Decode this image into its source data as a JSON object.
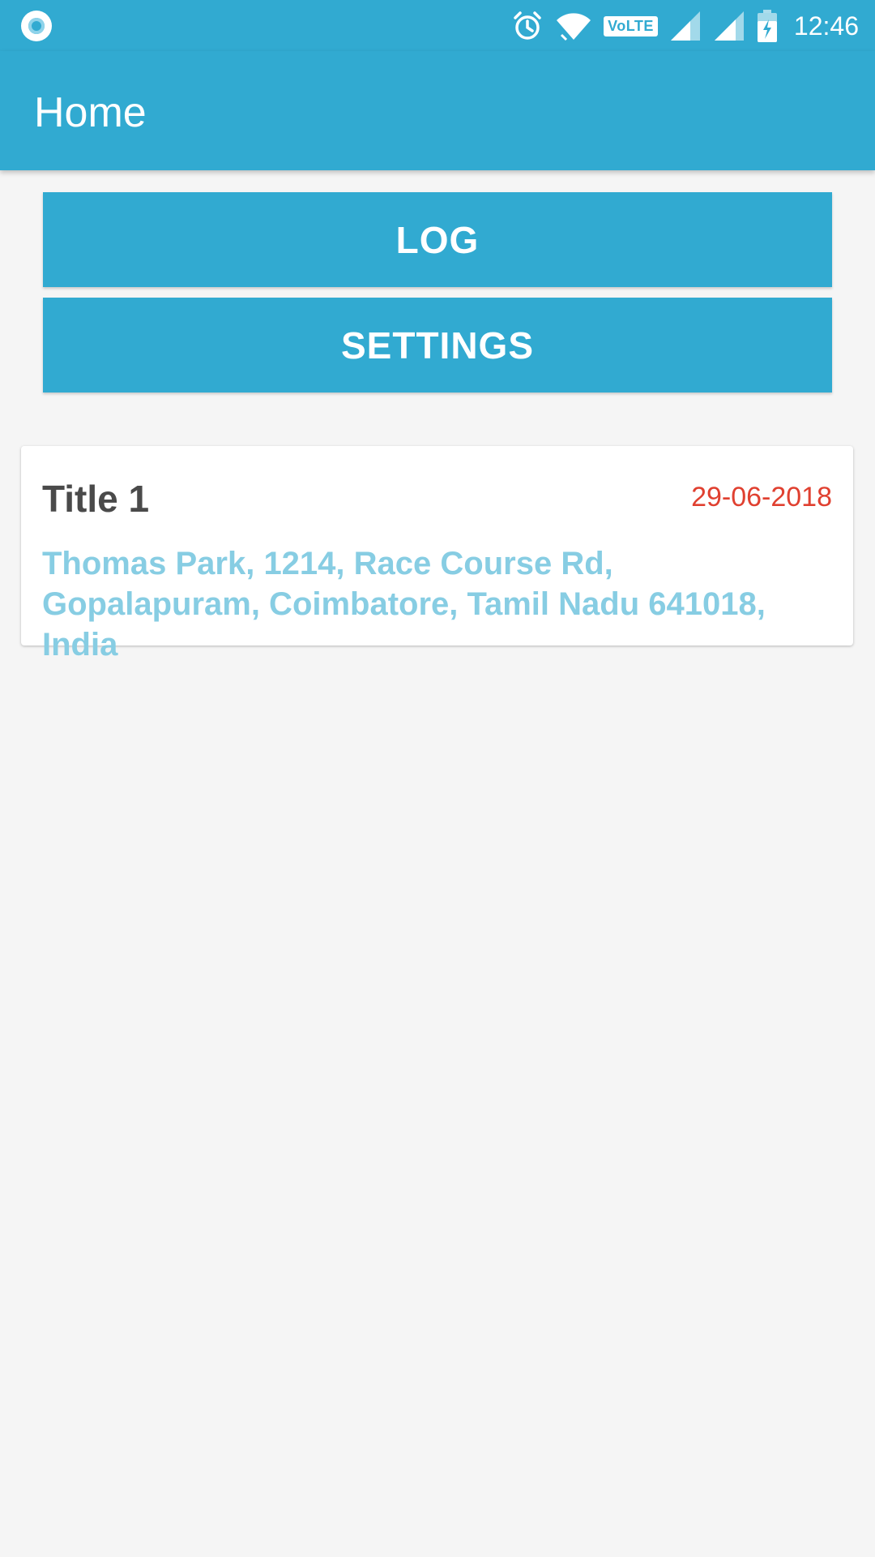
{
  "status_bar": {
    "time": "12:46",
    "volte_label": "VoLTE",
    "icons": [
      "notification-dot-icon",
      "alarm-icon",
      "wifi-icon",
      "volte-icon",
      "signal-icon",
      "signal-icon",
      "battery-charging-icon"
    ]
  },
  "app_bar": {
    "title": "Home"
  },
  "buttons": {
    "log_label": "LOG",
    "settings_label": "SETTINGS"
  },
  "cards": [
    {
      "title": "Title 1",
      "date": "29-06-2018",
      "address": "Thomas Park, 1214, Race Course Rd, Gopalapuram, Coimbatore, Tamil Nadu 641018, India"
    }
  ],
  "colors": {
    "primary": "#31aad1",
    "background": "#f5f5f5",
    "date_text": "#e04030",
    "address_text": "#87cde3",
    "title_text": "#4a4a4a"
  }
}
